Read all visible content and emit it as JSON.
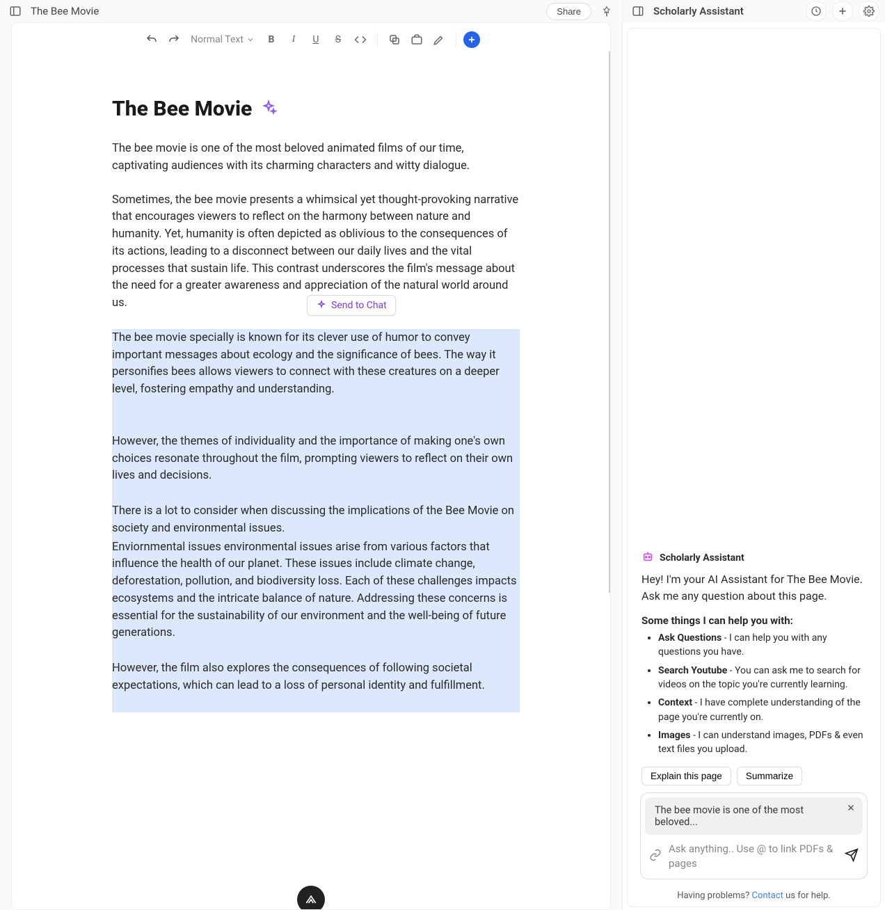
{
  "header": {
    "doc_title": "The Bee Movie",
    "share_label": "Share"
  },
  "toolbar": {
    "text_style": "Normal Text"
  },
  "document": {
    "title": "The Bee Movie",
    "p1": "The bee movie is one of the most beloved animated films of our time, captivating audiences with its charming characters and witty dialogue.",
    "p2": "Sometimes, the bee movie presents a whimsical yet thought-provoking narrative that encourages viewers to reflect on the harmony between nature and humanity. Yet, humanity is often depicted as oblivious to the consequences of its actions, leading to a disconnect between our daily lives and the vital processes that sustain life. This contrast underscores the film's message about the need for a greater awareness and appreciation of the natural world around us.",
    "p3": "The bee movie specially is known for its clever use of humor to convey important messages about ecology and the significance of bees. The way it personifies bees allows viewers to connect with these creatures on a deeper level, fostering empathy and understanding.",
    "p4": "However, the themes of individuality and the importance of making one's own choices resonate throughout the film, prompting viewers to reflect on their own lives and decisions.",
    "p5": "There is a lot to consider when discussing the implications of the Bee Movie on society and environmental issues.",
    "p6": "Enviornmental issues environmental issues arise from various factors that influence the health of our planet. These issues include climate change, deforestation, pollution, and biodiversity loss. Each of these challenges impacts ecosystems and the intricate balance of nature. Addressing these concerns is essential for the sustainability of our environment and the well-being of future generations.",
    "p7": "However, the film also explores the consequences of following societal expectations, which can lead to a loss of personal identity and fulfillment.",
    "send_to_chat": "Send to Chat"
  },
  "assistant": {
    "name": "Scholarly Assistant",
    "greeting": "Hey! I'm your AI Assistant for The Bee Movie. Ask me any question about this page.",
    "heading": "Some things I can help you with:",
    "items": [
      {
        "title": "Ask Questions",
        "desc": " - I can help you with any questions you have."
      },
      {
        "title": "Search Youtube",
        "desc": " - You can ask me to search for videos on the topic you're currently learning."
      },
      {
        "title": "Context",
        "desc": " - I have complete understanding of the page you're currently on."
      },
      {
        "title": "Images",
        "desc": " - I can understand images, PDFs & even text files you upload."
      }
    ],
    "chips": {
      "explain": "Explain this page",
      "summarize": "Summarize"
    },
    "quoted": "The bee movie is one of the most beloved...",
    "placeholder": "Ask anything.. Use @ to link PDFs & pages",
    "footer_prefix": "Having problems? ",
    "footer_link": "Contact",
    "footer_suffix": " us for help."
  }
}
